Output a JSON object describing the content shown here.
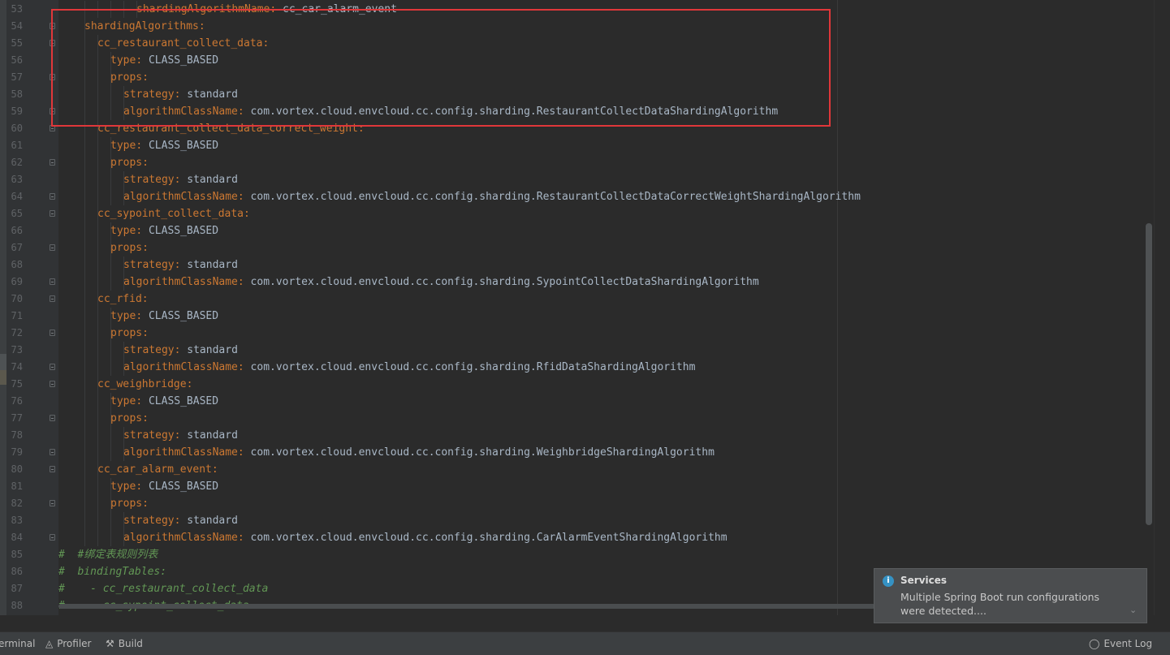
{
  "editor": {
    "lines": [
      {
        "no": "53",
        "indent": 6,
        "key": "shardingAlgorithmName",
        "value": "cc_car_alarm_event",
        "type": "kv",
        "fold": false
      },
      {
        "no": "54",
        "indent": 2,
        "key": "shardingAlgorithms",
        "value": "",
        "type": "kv",
        "fold": true
      },
      {
        "no": "55",
        "indent": 3,
        "key": "cc_restaurant_collect_data",
        "value": "",
        "type": "kv",
        "fold": true
      },
      {
        "no": "56",
        "indent": 4,
        "key": "type",
        "value": "CLASS_BASED",
        "type": "kv",
        "fold": false
      },
      {
        "no": "57",
        "indent": 4,
        "key": "props",
        "value": "",
        "type": "kv",
        "fold": true
      },
      {
        "no": "58",
        "indent": 5,
        "key": "strategy",
        "value": "standard",
        "type": "kv",
        "fold": false
      },
      {
        "no": "59",
        "indent": 5,
        "key": "algorithmClassName",
        "value": "com.vortex.cloud.envcloud.cc.config.sharding.RestaurantCollectDataShardingAlgorithm",
        "type": "kv",
        "fold": true
      },
      {
        "no": "60",
        "indent": 3,
        "key": "cc_restaurant_collect_data_correct_weight",
        "value": "",
        "type": "kv",
        "fold": true
      },
      {
        "no": "61",
        "indent": 4,
        "key": "type",
        "value": "CLASS_BASED",
        "type": "kv",
        "fold": false
      },
      {
        "no": "62",
        "indent": 4,
        "key": "props",
        "value": "",
        "type": "kv",
        "fold": true
      },
      {
        "no": "63",
        "indent": 5,
        "key": "strategy",
        "value": "standard",
        "type": "kv",
        "fold": false
      },
      {
        "no": "64",
        "indent": 5,
        "key": "algorithmClassName",
        "value": "com.vortex.cloud.envcloud.cc.config.sharding.RestaurantCollectDataCorrectWeightShardingAlgorithm",
        "type": "kv",
        "fold": true
      },
      {
        "no": "65",
        "indent": 3,
        "key": "cc_sypoint_collect_data",
        "value": "",
        "type": "kv",
        "fold": true
      },
      {
        "no": "66",
        "indent": 4,
        "key": "type",
        "value": "CLASS_BASED",
        "type": "kv",
        "fold": false
      },
      {
        "no": "67",
        "indent": 4,
        "key": "props",
        "value": "",
        "type": "kv",
        "fold": true
      },
      {
        "no": "68",
        "indent": 5,
        "key": "strategy",
        "value": "standard",
        "type": "kv",
        "fold": false
      },
      {
        "no": "69",
        "indent": 5,
        "key": "algorithmClassName",
        "value": "com.vortex.cloud.envcloud.cc.config.sharding.SypointCollectDataShardingAlgorithm",
        "type": "kv",
        "fold": true
      },
      {
        "no": "70",
        "indent": 3,
        "key": "cc_rfid",
        "value": "",
        "type": "kv",
        "fold": true
      },
      {
        "no": "71",
        "indent": 4,
        "key": "type",
        "value": "CLASS_BASED",
        "type": "kv",
        "fold": false
      },
      {
        "no": "72",
        "indent": 4,
        "key": "props",
        "value": "",
        "type": "kv",
        "fold": true
      },
      {
        "no": "73",
        "indent": 5,
        "key": "strategy",
        "value": "standard",
        "type": "kv",
        "fold": false
      },
      {
        "no": "74",
        "indent": 5,
        "key": "algorithmClassName",
        "value": "com.vortex.cloud.envcloud.cc.config.sharding.RfidDataShardingAlgorithm",
        "type": "kv",
        "fold": true
      },
      {
        "no": "75",
        "indent": 3,
        "key": "cc_weighbridge",
        "value": "",
        "type": "kv",
        "fold": true
      },
      {
        "no": "76",
        "indent": 4,
        "key": "type",
        "value": "CLASS_BASED",
        "type": "kv",
        "fold": false
      },
      {
        "no": "77",
        "indent": 4,
        "key": "props",
        "value": "",
        "type": "kv",
        "fold": true
      },
      {
        "no": "78",
        "indent": 5,
        "key": "strategy",
        "value": "standard",
        "type": "kv",
        "fold": false
      },
      {
        "no": "79",
        "indent": 5,
        "key": "algorithmClassName",
        "value": "com.vortex.cloud.envcloud.cc.config.sharding.WeighbridgeShardingAlgorithm",
        "type": "kv",
        "fold": true
      },
      {
        "no": "80",
        "indent": 3,
        "key": "cc_car_alarm_event",
        "value": "",
        "type": "kv",
        "fold": true
      },
      {
        "no": "81",
        "indent": 4,
        "key": "type",
        "value": "CLASS_BASED",
        "type": "kv",
        "fold": false
      },
      {
        "no": "82",
        "indent": 4,
        "key": "props",
        "value": "",
        "type": "kv",
        "fold": true
      },
      {
        "no": "83",
        "indent": 5,
        "key": "strategy",
        "value": "standard",
        "type": "kv",
        "fold": false
      },
      {
        "no": "84",
        "indent": 5,
        "key": "algorithmClassName",
        "value": "com.vortex.cloud.envcloud.cc.config.sharding.CarAlarmEventShardingAlgorithm",
        "type": "kv",
        "fold": true
      },
      {
        "no": "85",
        "indent": 0,
        "text": "#  #绑定表规则列表",
        "type": "comment",
        "fold": false
      },
      {
        "no": "86",
        "indent": 0,
        "text": "#  bindingTables:",
        "type": "comment",
        "fold": false
      },
      {
        "no": "87",
        "indent": 0,
        "text": "#    - cc_restaurant_collect_data",
        "type": "comment",
        "fold": false
      },
      {
        "no": "88",
        "indent": 0,
        "text": "#    - cc_sypoint_collect_data",
        "type": "comment",
        "fold": false
      }
    ]
  },
  "notification": {
    "title": "Services",
    "message": "Multiple Spring Boot run configurations were detected...."
  },
  "statusbar": {
    "terminal": "erminal",
    "profiler": "Profiler",
    "build": "Build",
    "event_log": "Event Log"
  },
  "colors": {
    "key": "#cc7832",
    "value": "#a9b7c6",
    "comment": "#629755",
    "highlight_border": "#e0373a",
    "info": "#3592c4"
  }
}
